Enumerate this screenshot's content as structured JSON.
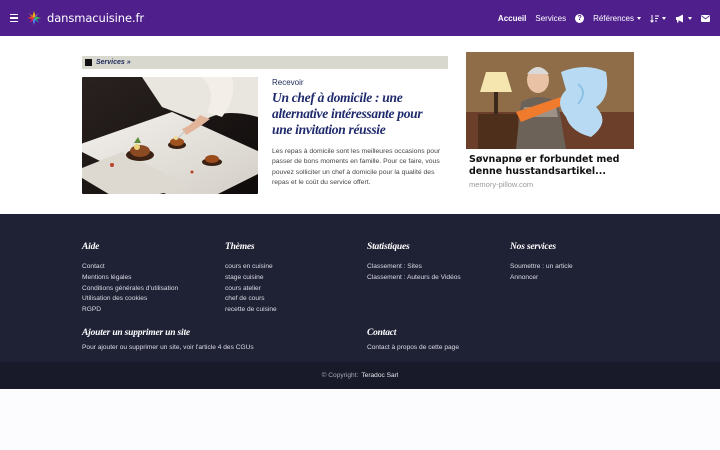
{
  "nav": {
    "brand": "dansmacuisine.fr",
    "items": {
      "home": "Accueil",
      "services": "Services",
      "references": "Références"
    }
  },
  "section": {
    "label": "Services »"
  },
  "article": {
    "kicker": "Recevoir",
    "title": "Un chef à domicile : une alternative intéressante pour une invitation réussie",
    "excerpt": "Les repas à domicile sont les meilleures occasions pour passer de bons moments en famille. Pour ce faire, vous pouvez solliciter un chef à domicile pour la qualité des repas et le coût du service offert."
  },
  "ad": {
    "title": "Søvnapnø er forbundet med denne husstandsartikel...",
    "source": "memory-pillow.com"
  },
  "footer": {
    "aide": {
      "heading": "Aide",
      "links": [
        "Contact",
        "Mentions légales",
        "Conditions générales d'utilisation",
        "Utilisation des cookies",
        "RGPD"
      ]
    },
    "themes": {
      "heading": "Thèmes",
      "links": [
        "cours en cuisine",
        "stage cuisine",
        "cours atelier",
        "chef de cours",
        "recette de cuisine"
      ]
    },
    "stats": {
      "heading": "Statistiques",
      "links": [
        "Classement : Sites",
        "Classement : Auteurs de Vidéos"
      ]
    },
    "services": {
      "heading": "Nos services",
      "links": [
        "Soumettre : un article",
        "Annoncer"
      ]
    },
    "addremove": {
      "heading": "Ajouter un supprimer un site",
      "text": "Pour ajouter ou supprimer un site, voir l'article 4 des CGUs"
    },
    "contact": {
      "heading": "Contact",
      "text": "Contact à propos de cette page"
    },
    "copyright_label": "© Copyright:",
    "copyright_owner": "Teradoc Sarl"
  },
  "colors": {
    "navbar": "#4f1f8c",
    "footer": "#1f2135",
    "title": "#1f2a6c"
  }
}
